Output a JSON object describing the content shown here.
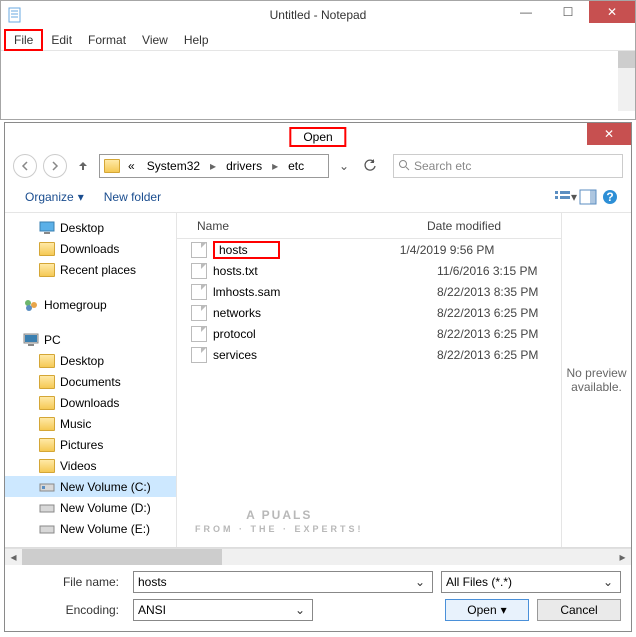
{
  "notepad": {
    "title": "Untitled - Notepad",
    "menu": {
      "file": "File",
      "edit": "Edit",
      "format": "Format",
      "view": "View",
      "help": "Help"
    }
  },
  "dialog": {
    "title": "Open",
    "nav": {
      "back": "←",
      "fwd": "→",
      "up": "↑",
      "refresh": "⟳"
    },
    "breadcrumb": {
      "sep_prefix": "«",
      "p1": "System32",
      "p2": "drivers",
      "p3": "etc"
    },
    "search_placeholder": "Search etc",
    "toolbar": {
      "organize": "Organize",
      "newfolder": "New folder"
    },
    "cols": {
      "name": "Name",
      "date": "Date modified"
    },
    "tree": {
      "desktop": "Desktop",
      "downloads": "Downloads",
      "recent": "Recent places",
      "homegroup": "Homegroup",
      "pc": "PC",
      "pc_desktop": "Desktop",
      "pc_documents": "Documents",
      "pc_downloads": "Downloads",
      "pc_music": "Music",
      "pc_pictures": "Pictures",
      "pc_videos": "Videos",
      "vol_c": "New Volume (C:)",
      "vol_d": "New Volume (D:)",
      "vol_e": "New Volume (E:)"
    },
    "files": [
      {
        "name": "hosts",
        "date": "1/4/2019 9:56 PM"
      },
      {
        "name": "hosts.txt",
        "date": "11/6/2016 3:15 PM"
      },
      {
        "name": "lmhosts.sam",
        "date": "8/22/2013 8:35 PM"
      },
      {
        "name": "networks",
        "date": "8/22/2013 6:25 PM"
      },
      {
        "name": "protocol",
        "date": "8/22/2013 6:25 PM"
      },
      {
        "name": "services",
        "date": "8/22/2013 6:25 PM"
      }
    ],
    "preview": "No preview available.",
    "filename_label": "File name:",
    "filename_value": "hosts",
    "filetype_value": "All Files  (*.*)",
    "encoding_label": "Encoding:",
    "encoding_value": "ANSI",
    "open_btn": "Open",
    "cancel_btn": "Cancel"
  },
  "watermark": {
    "brand": "A  PUALS",
    "sub": "FROM · THE · EXPERTS!"
  }
}
